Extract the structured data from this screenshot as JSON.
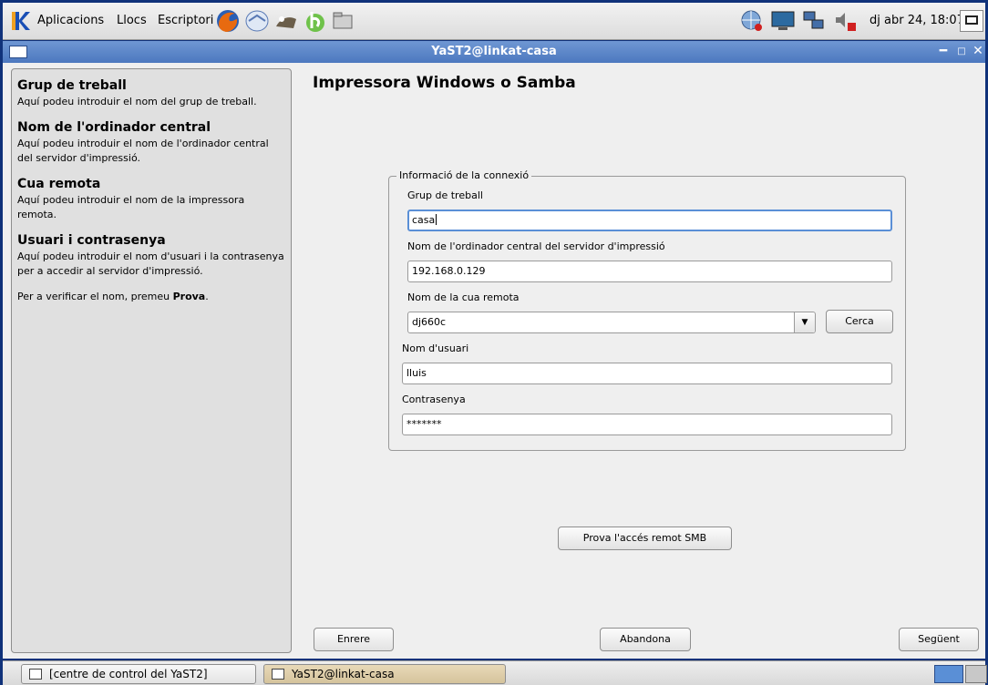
{
  "top_panel": {
    "menus": [
      "Aplicacions",
      "Llocs",
      "Escriptori"
    ],
    "launcher_icons": [
      "firefox-icon",
      "evolution-icon",
      "gimp-icon",
      "bittorrent-icon",
      "file-manager-icon"
    ],
    "tray_icons": [
      "network-globe-icon",
      "monitor-icon",
      "network-computers-icon",
      "volume-muted-icon"
    ],
    "clock": "dj abr 24, 18:07"
  },
  "window": {
    "title": "YaST2@linkat-casa"
  },
  "help": {
    "sections": [
      {
        "heading": "Grup de treball",
        "text": "Aquí podeu introduir el nom del grup de treball."
      },
      {
        "heading": "Nom de l'ordinador central",
        "text": "Aquí podeu introduir el nom de l'ordinador central del servidor d'impressió."
      },
      {
        "heading": "Cua remota",
        "text": "Aquí podeu introduir el nom de la impressora remota."
      },
      {
        "heading": "Usuari i contrasenya",
        "text": "Aquí podeu introduir el nom d'usuari i la contrasenya per a accedir al servidor d'impressió."
      }
    ],
    "verify_prefix": "Per a verificar el nom, premeu ",
    "verify_bold": "Prova",
    "verify_suffix": "."
  },
  "page": {
    "heading": "Impressora Windows o Samba"
  },
  "form": {
    "frame_title": "Informació de la connexió",
    "workgroup": {
      "label": "Grup de treball",
      "value": "casa"
    },
    "host": {
      "label": "Nom de l'ordinador central del servidor d'impressió",
      "value": "192.168.0.129"
    },
    "queue": {
      "label": "Nom de la cua remota",
      "value": "dj660c"
    },
    "search_button": "Cerca",
    "user": {
      "label": "Nom d'usuari",
      "value": "lluis"
    },
    "password": {
      "label": "Contrasenya",
      "value": "*******"
    },
    "test_button": "Prova l'accés remot SMB"
  },
  "buttons": {
    "back": "Enrere",
    "abort": "Abandona",
    "next": "Següent"
  },
  "taskbar": {
    "tasks": [
      "[centre de control del YaST2]",
      "YaST2@linkat-casa"
    ]
  }
}
